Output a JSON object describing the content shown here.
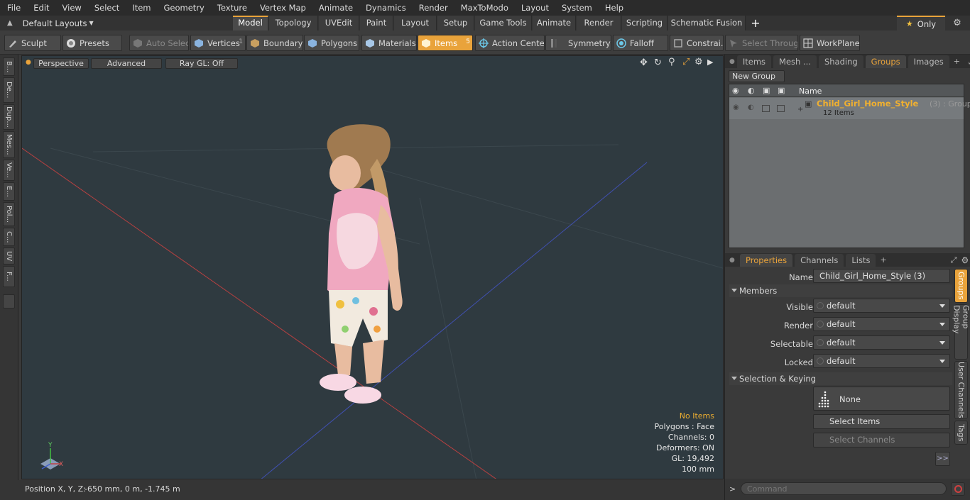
{
  "menu": [
    "File",
    "Edit",
    "View",
    "Select",
    "Item",
    "Geometry",
    "Texture",
    "Vertex Map",
    "Animate",
    "Dynamics",
    "Render",
    "MaxToModo",
    "Layout",
    "System",
    "Help"
  ],
  "modebar": {
    "layouts_label": "Default Layouts",
    "tabs": [
      "Model",
      "Topology",
      "UVEdit",
      "Paint",
      "Layout",
      "Setup",
      "Game Tools",
      "Animate",
      "Render",
      "Scripting",
      "Schematic Fusion"
    ],
    "add_label": "+",
    "only_label": "Only"
  },
  "toolbar": {
    "sculpt": "Sculpt",
    "presets": "Presets",
    "auto_select": "Auto Select",
    "vertices": "Vertices",
    "vertices_count": "1",
    "boundary": "Boundary",
    "polygons": "Polygons",
    "materials": "Materials",
    "items": "Items",
    "items_count": "5",
    "action_center": "Action Center",
    "symmetry": "Symmetry",
    "falloff": "Falloff",
    "constraints": "Constrai...",
    "select_through": "Select Through",
    "workplane": "WorkPlane"
  },
  "left_tabs": [
    "B...",
    "De...",
    "Dup...",
    "Mes...",
    "Ve...",
    "E...",
    "Pol...",
    "C...",
    "UV",
    "F..."
  ],
  "viewport": {
    "perspective": "Perspective",
    "advanced": "Advanced",
    "raygl": "Ray GL: Off",
    "stats": {
      "no_items": "No Items",
      "polygons": "Polygons : Face",
      "channels": "Channels: 0",
      "deformers": "Deformers: ON",
      "gl": "GL: 19,492",
      "scale": "100 mm"
    },
    "axis_y": "Y",
    "axis_x": "X"
  },
  "status": {
    "position_label": "Position X, Y, Z:",
    "position_value": "-650 mm, 0 m, -1.745 m"
  },
  "top_panel": {
    "tabs": [
      "Items",
      "Mesh ...",
      "Shading",
      "Groups",
      "Images"
    ],
    "active_tab": "Groups",
    "new_group": "New Group",
    "name_header": "Name",
    "group_name": "Child_Girl_Home_Style",
    "group_suffix": "(3) : Group",
    "group_items": "12 Items"
  },
  "properties": {
    "tabs": [
      "Properties",
      "Channels",
      "Lists"
    ],
    "name_label": "Name",
    "name_value": "Child_Girl_Home_Style (3)",
    "members_header": "Members",
    "rows": [
      {
        "label": "Visible",
        "value": "default"
      },
      {
        "label": "Render",
        "value": "default"
      },
      {
        "label": "Selectable",
        "value": "default"
      },
      {
        "label": "Locked",
        "value": "default"
      }
    ],
    "selection_header": "Selection & Keying",
    "none_label": "None",
    "select_items": "Select Items",
    "select_channels": "Select Channels",
    "more": ">>",
    "side_tabs": [
      "Groups",
      "Group Display",
      "User Channels",
      "Tags"
    ]
  },
  "command": {
    "prompt": ">",
    "placeholder": "Command"
  }
}
